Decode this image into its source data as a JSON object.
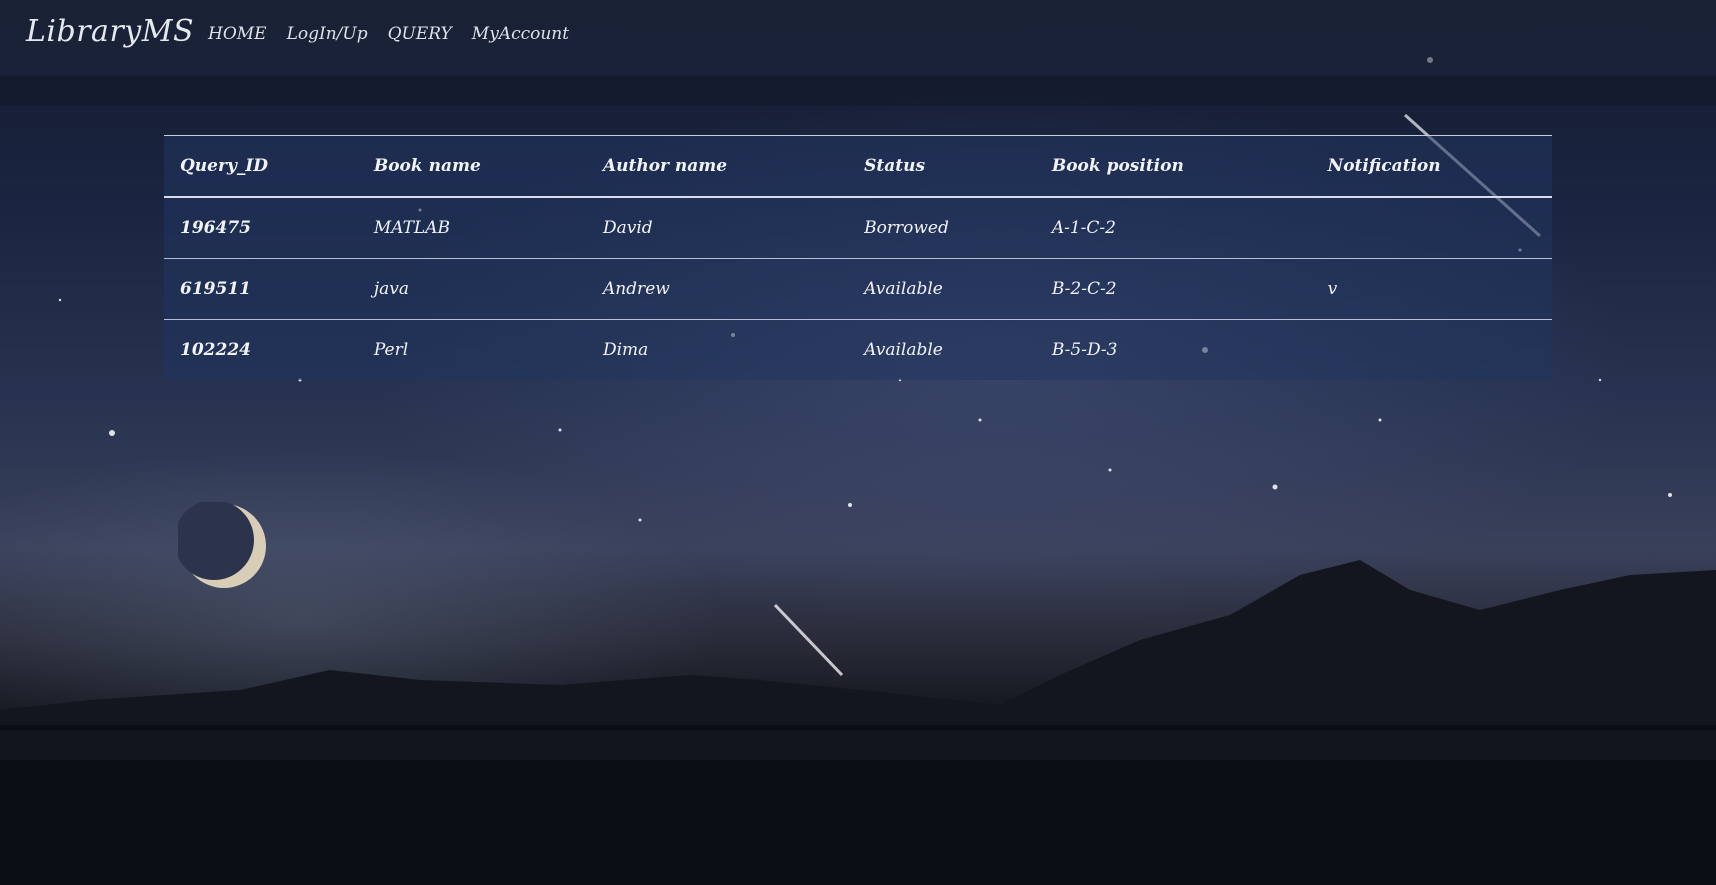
{
  "nav": {
    "brand": "LibraryMS",
    "links": [
      "HOME",
      "LogIn/Up",
      "QUERY",
      "MyAccount"
    ]
  },
  "table": {
    "headers": [
      "Query_ID",
      "Book name",
      "Author name",
      "Status",
      "Book position",
      "Notification"
    ],
    "rows": [
      [
        "196475",
        "MATLAB",
        "David",
        "Borrowed",
        "A-1-C-2",
        ""
      ],
      [
        "619511",
        "java",
        "Andrew",
        "Available",
        "B-2-C-2",
        "v"
      ],
      [
        "102224",
        "Perl",
        "Dima",
        "Available",
        "B-5-D-3",
        ""
      ]
    ]
  },
  "colors": {
    "nav_text": "#dfe2ea",
    "table_bg": "#20345f",
    "border": "#c8cedd"
  },
  "icons": [
    "moon-icon"
  ]
}
